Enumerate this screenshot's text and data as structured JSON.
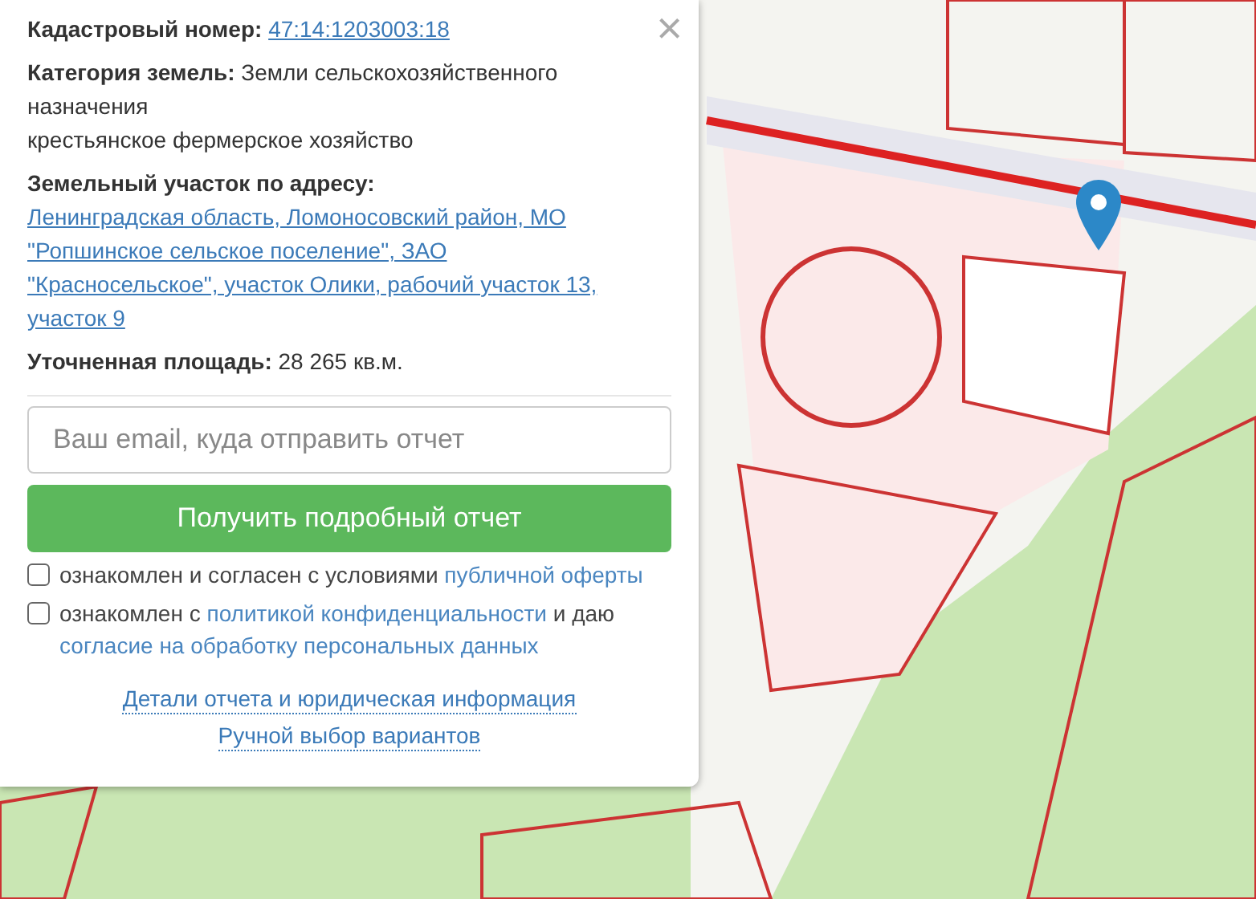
{
  "popup": {
    "fields": [
      {
        "kind": "link",
        "label": "Кадастровый номер:",
        "value": "47:14:1203003:18"
      },
      {
        "kind": "lines",
        "label": "Категория земель:",
        "lines": [
          "Земли сельскохозяйственного назначения",
          "крестьянское фермерское хозяйство"
        ]
      },
      {
        "kind": "block-link",
        "label": "Земельный участок по адресу:",
        "value": "Ленинградская область, Ломоносовский район, МО \"Ропшинское сельское поселение\", ЗАО \"Красносельское\", участок Олики, рабочий участок 13, участок 9"
      },
      {
        "kind": "text",
        "label": "Уточненная площадь:",
        "value": "28 265 кв.м."
      }
    ],
    "email": {
      "placeholder": "Ваш email, куда отправить отчет"
    },
    "submit": "Получить подробный отчет",
    "agreements": [
      {
        "checked": false,
        "parts": [
          {
            "kind": "text",
            "text": "ознакомлен и согласен с условиями "
          },
          {
            "kind": "link",
            "text": "публичной оферты"
          }
        ]
      },
      {
        "checked": false,
        "parts": [
          {
            "kind": "text",
            "text": "ознакомлен с "
          },
          {
            "kind": "link",
            "text": "политикой конфиденциальности"
          },
          {
            "kind": "text",
            "text": " и даю "
          },
          {
            "kind": "link",
            "text": "согласие на обработку персональных данных"
          }
        ]
      }
    ],
    "links": [
      "Детали отчета и юридическая информация",
      "Ручной выбор вариантов"
    ],
    "close": "×"
  }
}
